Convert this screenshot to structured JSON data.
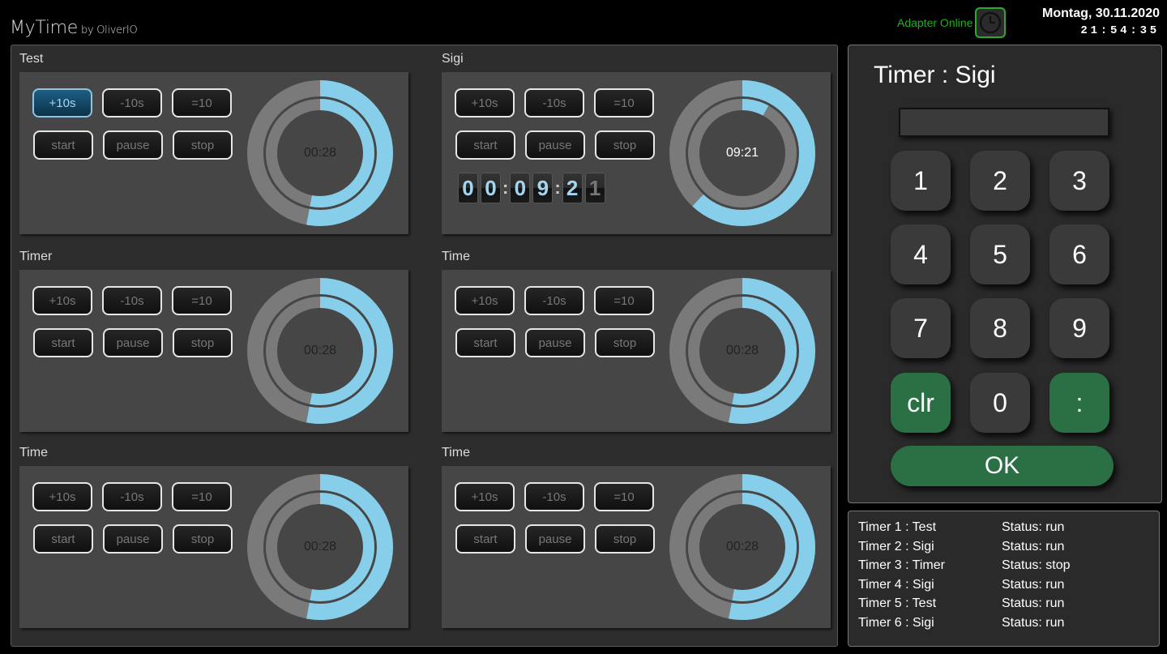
{
  "header": {
    "title": "MyTime",
    "byline": "by OliverIO",
    "adapter_status": "Adapter Online",
    "date": "Montag, 30.11.2020",
    "time": "21:54:35",
    "status_color": "#22b022"
  },
  "buttons": {
    "plus10": "+10s",
    "minus10": "-10s",
    "set10": "=10",
    "start": "start",
    "pause": "pause",
    "stop": "stop"
  },
  "timers": [
    {
      "label": "Test",
      "display": "00:28",
      "progress": 0.53,
      "inner_progress": 0.53,
      "active_button": "plus10"
    },
    {
      "label": "Sigi",
      "display": "09:21",
      "progress": 0.62,
      "inner_progress": 0.08,
      "flip_digits": [
        "0",
        "0",
        "0",
        "9",
        "2",
        "1"
      ]
    },
    {
      "label": "Timer",
      "display": "00:28",
      "progress": 0.53,
      "inner_progress": 0.53
    },
    {
      "label": "Time",
      "display": "00:28",
      "progress": 0.53,
      "inner_progress": 0.53
    },
    {
      "label": "Time",
      "display": "00:28",
      "progress": 0.53,
      "inner_progress": 0.53
    },
    {
      "label": "Time",
      "display": "00:28",
      "progress": 0.53,
      "inner_progress": 0.53
    }
  ],
  "keypad": {
    "title": "Timer : Sigi",
    "display_value": "",
    "keys": [
      "1",
      "2",
      "3",
      "4",
      "5",
      "6",
      "7",
      "8",
      "9",
      "clr",
      "0",
      ":"
    ],
    "ok": "OK"
  },
  "status_list": [
    {
      "name": "Timer 1 : Test",
      "status": "Status: run"
    },
    {
      "name": "Timer 2 : Sigi",
      "status": "Status: run"
    },
    {
      "name": "Timer 3 : Timer",
      "status": "Status: stop"
    },
    {
      "name": "Timer 4 : Sigi",
      "status": "Status: run"
    },
    {
      "name": "Timer 5 : Test",
      "status": "Status: run"
    },
    {
      "name": "Timer 6 : Sigi",
      "status": "Status: run"
    }
  ],
  "colors": {
    "ring_fill": "#87ceeb",
    "ring_track": "#7a7a7a",
    "green": "#2a7044"
  }
}
